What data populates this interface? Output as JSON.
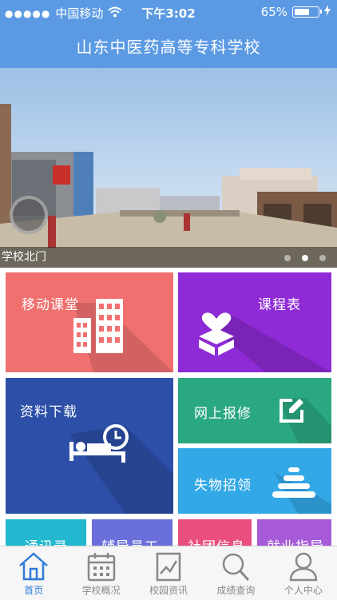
{
  "status_bar": {
    "carrier": "中国移动",
    "time": "下午3:02",
    "battery": "65%",
    "battery_level": 0.65
  },
  "header": {
    "title": "山东中医药高等专科学校"
  },
  "banner": {
    "caption": "学校北门",
    "dot_count": 3,
    "active_dot": 2
  },
  "tiles": [
    {
      "label": "移动课堂",
      "color": "#f07070"
    },
    {
      "label": "课程表",
      "color": "#8f2bd6"
    },
    {
      "label": "资料下载",
      "color": "#2d4fa8"
    },
    {
      "label": "网上报修",
      "color": "#2aa882"
    },
    {
      "label": "失物招领",
      "color": "#33a8e6"
    },
    {
      "label": "通讯录",
      "color": "#22b8d0"
    },
    {
      "label": "辅导员工作",
      "color": "#6b6fdc"
    },
    {
      "label": "社团信息",
      "color": "#e94e7f"
    },
    {
      "label": "就业指导",
      "color": "#a65ad8"
    }
  ],
  "tabbar": {
    "active_color": "#2f7bd8",
    "tabs": [
      {
        "label": "首页",
        "icon": "home-icon"
      },
      {
        "label": "学校概况",
        "icon": "calendar-icon"
      },
      {
        "label": "校园资讯",
        "icon": "chart-icon"
      },
      {
        "label": "成绩查询",
        "icon": "search-icon"
      },
      {
        "label": "个人中心",
        "icon": "user-icon"
      }
    ]
  }
}
